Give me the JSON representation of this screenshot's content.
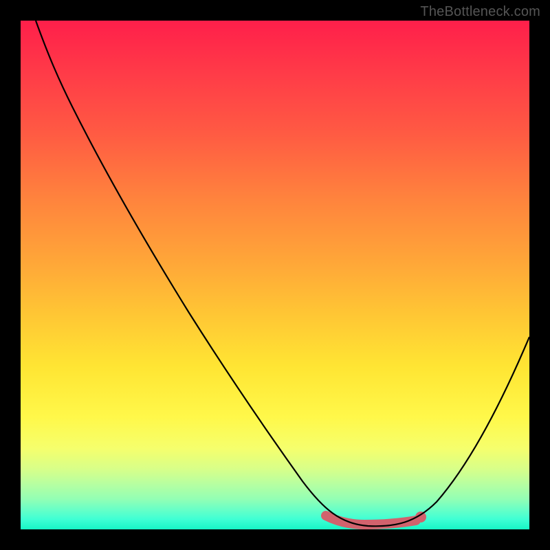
{
  "watermark": "TheBottleneck.com",
  "colors": {
    "gradient_top": "#ff1f4a",
    "gradient_bottom": "#17f5c6",
    "curve": "#000000",
    "marker": "#d1626d",
    "frame": "#000000"
  },
  "chart_data": {
    "type": "line",
    "title": "",
    "xlabel": "",
    "ylabel": "",
    "xlim": [
      0,
      100
    ],
    "ylim": [
      0,
      100
    ],
    "series": [
      {
        "name": "bottleneck-curve",
        "x": [
          3,
          8,
          14,
          20,
          26,
          32,
          38,
          44,
          50,
          55,
          58,
          62,
          66,
          70,
          74,
          78,
          84,
          90,
          96,
          100
        ],
        "y": [
          100,
          90,
          80,
          70,
          60,
          50,
          41,
          32,
          23,
          15,
          10,
          5,
          2,
          0,
          0,
          0,
          6,
          16,
          28,
          38
        ]
      }
    ],
    "annotations": [
      {
        "name": "recommended-range",
        "type": "segment",
        "x_start": 60,
        "x_end": 78,
        "y": 0
      },
      {
        "name": "recommended-point",
        "type": "point",
        "x": 78,
        "y": 1
      }
    ]
  }
}
